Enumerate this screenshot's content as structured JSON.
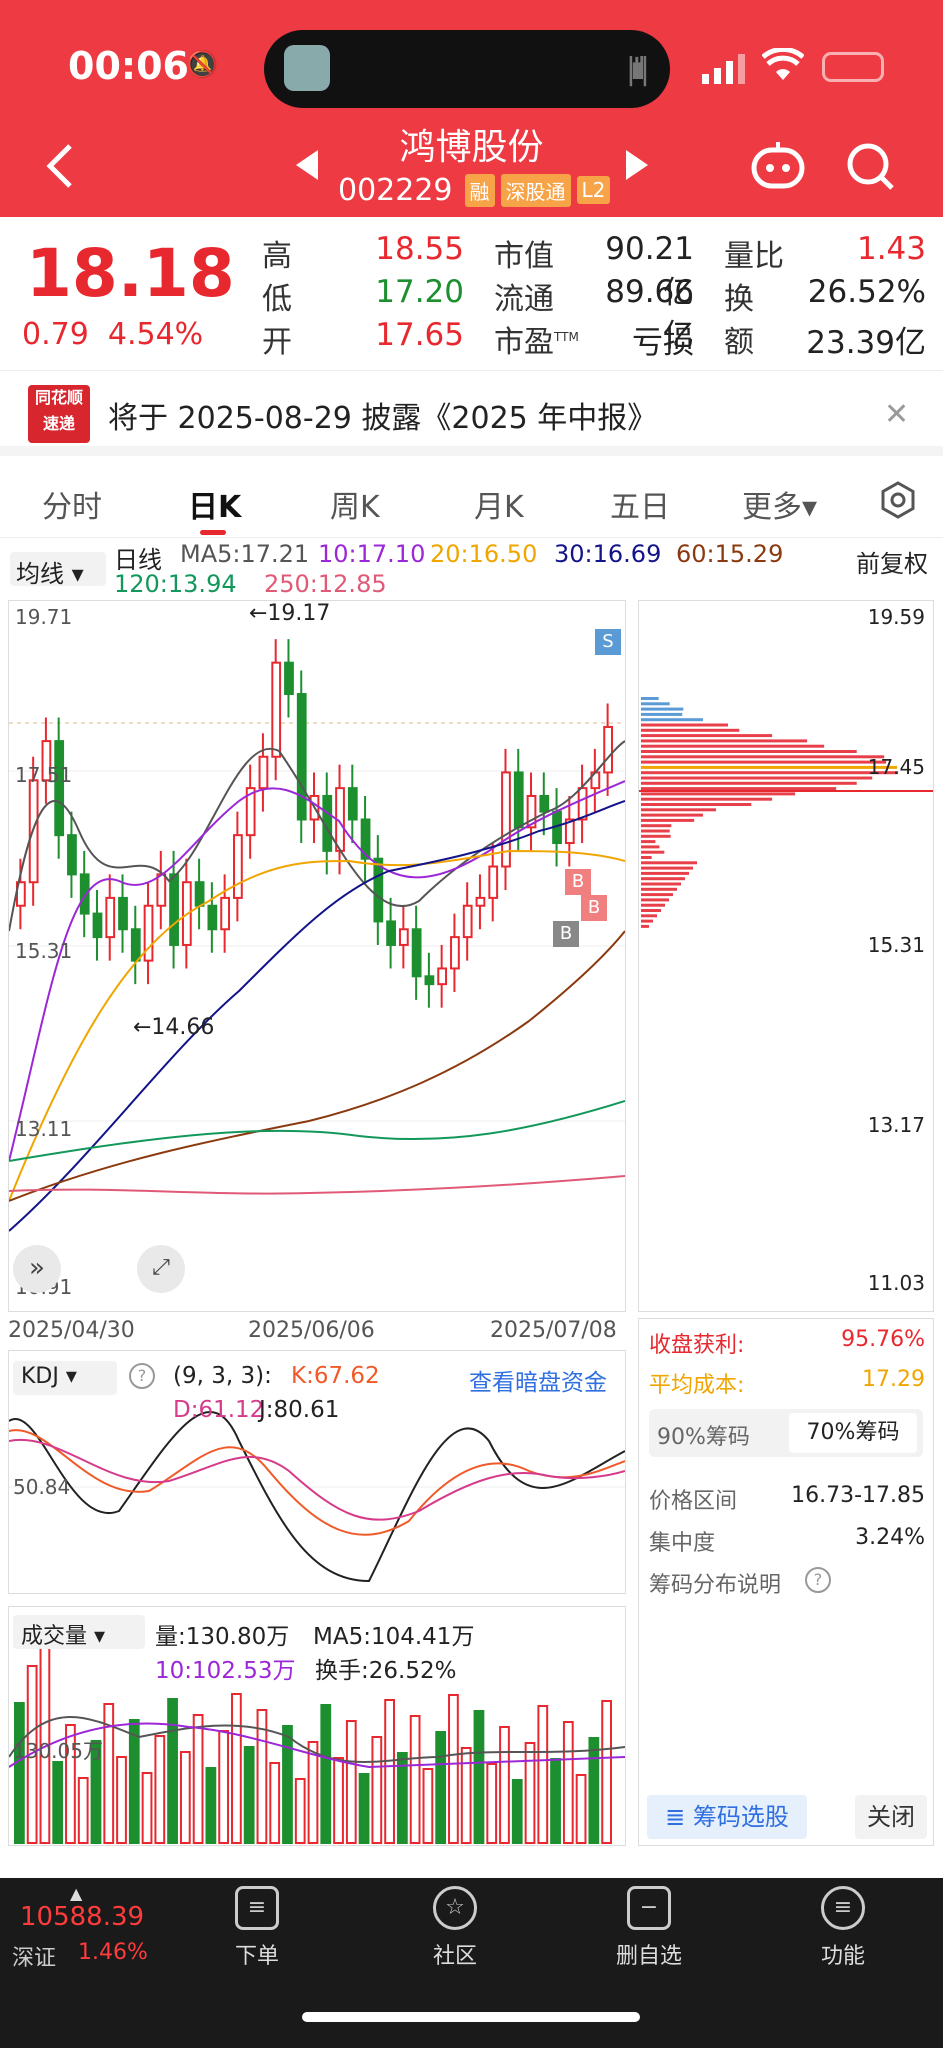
{
  "status": {
    "time": "00:06"
  },
  "header": {
    "title": "鸿博股份",
    "code": "002229",
    "tags": [
      "融",
      "深股通",
      "L2"
    ]
  },
  "quote": {
    "price": "18.18",
    "change": "0.79",
    "change_pct": "4.54%",
    "high_label": "高",
    "high": "18.55",
    "low_label": "低",
    "low": "17.20",
    "open_label": "开",
    "open": "17.65",
    "mcap_label": "市值",
    "mcap": "90.21亿",
    "float_label": "流通",
    "float": "89.66亿",
    "pe_label": "市盈",
    "pe_sup": "TTM",
    "pe": "亏损",
    "vr_label": "量比",
    "vr": "1.43",
    "turnover_label": "换",
    "turnover": "26.52%",
    "amount_label": "额",
    "amount": "23.39亿"
  },
  "notice": {
    "logo_top": "同花顺",
    "logo_bottom": "速递",
    "text": "将于 2025-08-29 披露《2025 年中报》"
  },
  "tabs": [
    "分时",
    "日K",
    "周K",
    "月K",
    "五日",
    "更多▾"
  ],
  "ma": {
    "selector": "均线 ▾",
    "period": "日线",
    "ma5": "MA5:17.21",
    "ma10": "10:17.10",
    "ma20": "20:16.50",
    "ma30": "30:16.69",
    "ma60": "60:15.29",
    "ma120": "120:13.94",
    "ma250": "250:12.85",
    "adjust": "前复权"
  },
  "kline": {
    "y_labels": [
      "19.71",
      "17.51",
      "15.31",
      "13.11",
      "10.91"
    ],
    "annot_high": "←19.17",
    "annot_low": "←14.66",
    "dates": [
      "2025/04/30",
      "2025/06/06",
      "2025/07/08"
    ],
    "markers": [
      "S",
      "B",
      "B",
      "B"
    ]
  },
  "chips": {
    "y_labels": [
      "19.59",
      "17.45",
      "15.31",
      "13.17",
      "11.03"
    ],
    "profit_label": "收盘获利:",
    "profit": "95.76%",
    "cost_label": "平均成本:",
    "cost": "17.29",
    "tab1": "90%筹码",
    "tab2": "70%筹码",
    "range_label": "价格区间",
    "range": "16.73-17.85",
    "conc_label": "集中度",
    "conc": "3.24%",
    "explain": "筹码分布说明",
    "select_btn": "筹码选股",
    "close_btn": "关闭"
  },
  "kdj": {
    "selector": "KDJ ▾",
    "params": "(9, 3, 3):",
    "k": "K:67.62",
    "d": "D:61.12",
    "j": "J:80.61",
    "link": "查看暗盘资金",
    "y_label": "50.84"
  },
  "volume": {
    "selector": "成交量 ▾",
    "vol": "量:130.80万",
    "ma5": "MA5:104.41万",
    "ma10": "10:102.53万",
    "turnover": "换手:26.52%",
    "y_label": "130.05万"
  },
  "index": {
    "value": "10588.39",
    "name": "深证",
    "pct": "1.46%"
  },
  "nav": [
    {
      "label": "下单",
      "icon": "order-icon"
    },
    {
      "label": "社区",
      "icon": "community-icon"
    },
    {
      "label": "删自选",
      "icon": "remove-watchlist-icon"
    },
    {
      "label": "功能",
      "icon": "menu-icon"
    }
  ],
  "colors": {
    "up": "#e8282f",
    "down": "#1d8f2f",
    "header": "#ee3a43"
  }
}
